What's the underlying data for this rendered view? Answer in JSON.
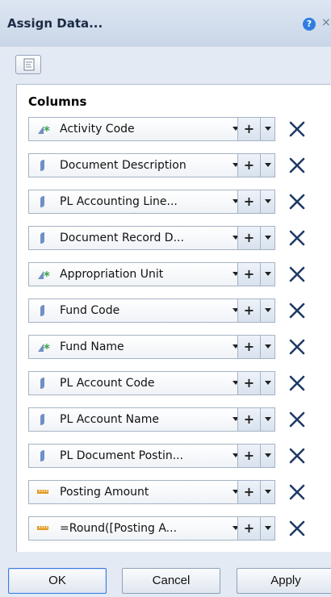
{
  "dialog": {
    "title": "Assign Data...",
    "help_glyph": "?",
    "close_glyph": "×"
  },
  "panel": {
    "columns_label": "Columns"
  },
  "rows": [
    {
      "label": "Activity Code",
      "icon": "dimension-icon"
    },
    {
      "label": "Document Description",
      "icon": "detail-icon"
    },
    {
      "label": "PL Accounting Line...",
      "icon": "detail-icon"
    },
    {
      "label": "Document Record D...",
      "icon": "detail-icon"
    },
    {
      "label": "Appropriation Unit",
      "icon": "dimension-icon"
    },
    {
      "label": "Fund Code",
      "icon": "detail-icon"
    },
    {
      "label": "Fund Name",
      "icon": "dimension-icon"
    },
    {
      "label": "PL Account Code",
      "icon": "detail-icon"
    },
    {
      "label": "PL Account Name",
      "icon": "detail-icon"
    },
    {
      "label": "PL Document Postin...",
      "icon": "detail-icon"
    },
    {
      "label": "Posting Amount",
      "icon": "measure-icon"
    },
    {
      "label": "=Round([Posting A...",
      "icon": "measure-icon"
    }
  ],
  "row_controls": {
    "plus_label": "+"
  },
  "footer": {
    "ok_label": "OK",
    "cancel_label": "Cancel",
    "apply_label": "Apply"
  },
  "colors": {
    "dimension_icon": "#3aa04a",
    "detail_icon": "#6f8fc6",
    "measure_icon": "#e39a22",
    "delete_icon": "#1f3a66",
    "dialog_bg": "#e3eaf4"
  }
}
